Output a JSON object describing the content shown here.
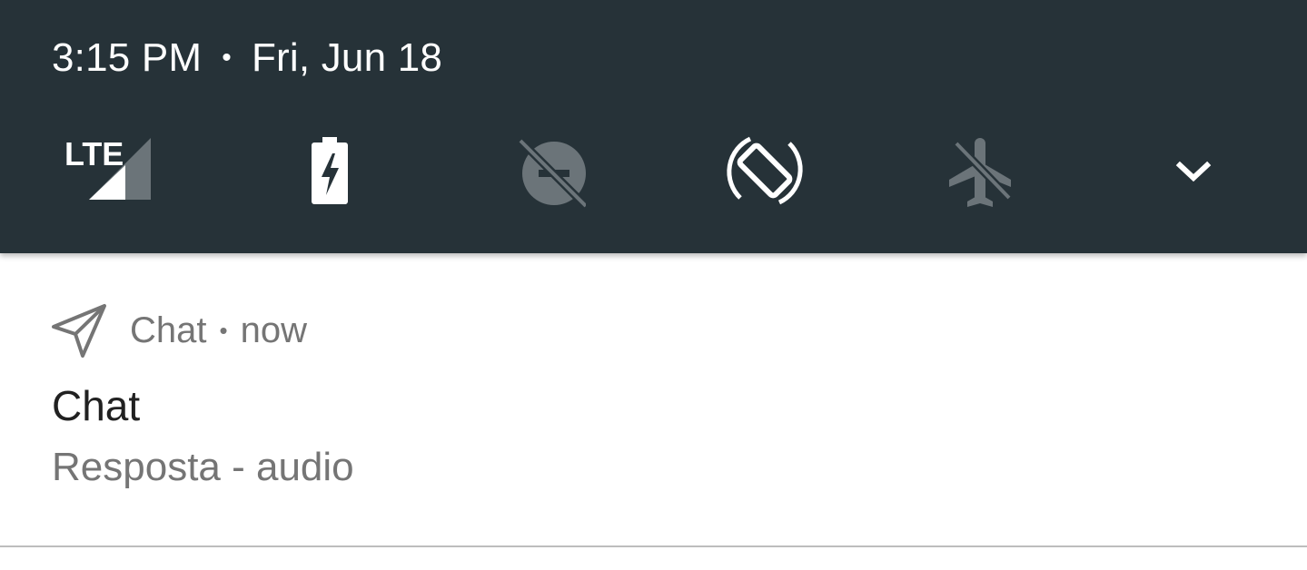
{
  "status": {
    "time": "3:15 PM",
    "separator": "•",
    "date": "Fri, Jun 18"
  },
  "quick_settings": {
    "tiles": [
      {
        "icon": "lte-signal-icon",
        "label": "LTE",
        "state": "on"
      },
      {
        "icon": "battery-charging-icon",
        "state": "on"
      },
      {
        "icon": "data-saver-off-icon",
        "state": "off"
      },
      {
        "icon": "auto-rotate-icon",
        "state": "on"
      },
      {
        "icon": "airplane-mode-off-icon",
        "state": "off"
      },
      {
        "icon": "expand-chevron-icon"
      }
    ]
  },
  "notification": {
    "app_icon": "send-icon",
    "app_name": "Chat",
    "separator": "•",
    "time": "now",
    "title": "Chat",
    "text": "Resposta - audio"
  },
  "colors": {
    "shade_background": "#263238",
    "active_icon": "#ffffff",
    "inactive_icon": "#6b7479",
    "secondary_text": "#757575",
    "primary_text": "#212121"
  }
}
